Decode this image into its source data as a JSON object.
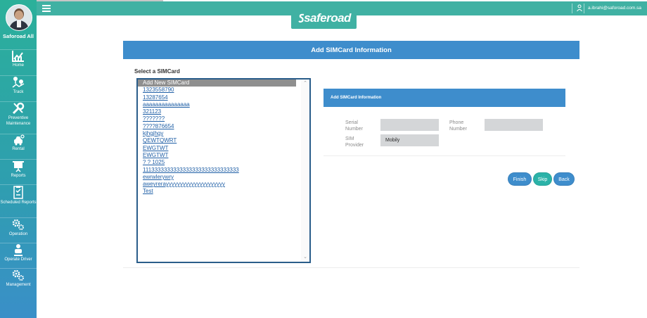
{
  "sidebar": {
    "user_name": "Saforoad All",
    "items": [
      {
        "label": "Home",
        "icon": "chart-icon"
      },
      {
        "label": "Track",
        "icon": "track-icon"
      },
      {
        "label": "Preventive Maintenance",
        "icon": "wrench-icon"
      },
      {
        "label": "Rental",
        "icon": "car-key-icon"
      },
      {
        "label": "Reports",
        "icon": "presentation-icon"
      },
      {
        "label": "Scheduled Reports",
        "icon": "clipboard-icon"
      },
      {
        "label": "Operation",
        "icon": "gears-icon"
      },
      {
        "label": "Operate Driver",
        "icon": "driver-icon"
      },
      {
        "label": "Management",
        "icon": "gears-icon"
      }
    ]
  },
  "topbar": {
    "email": "a.ibrahi@saforoad.com.sa"
  },
  "logo": {
    "text": "saferoad"
  },
  "page": {
    "title": "Add SIMCard Information",
    "select_label": "Select a SIMCard"
  },
  "simcards": [
    "Add New SIMCard",
    "1323558790",
    "13287654",
    "aaaaaaaaaaaaaaa",
    "321123",
    "???????",
    "????876654",
    "kjhgjhgy",
    "QEWTQWRT",
    "EWGTWT",
    "EWGTWT",
    "? ? 1025",
    "1113333333333333333333333333333",
    "ewrwlerywry",
    "aweyrerayyyyyyyyyyyyyyyyyyyyy",
    "Test"
  ],
  "panel": {
    "title": "Add SIMCard Information",
    "serial_label_1": "Serial",
    "serial_label_2": "Number",
    "phone_label_1": "Phone",
    "phone_label_2": "Number",
    "provider_label_1": "SIM",
    "provider_label_2": "Provider",
    "provider_value": "Mobily",
    "serial_value": "",
    "phone_value": ""
  },
  "buttons": {
    "finish": "Finish",
    "skip": "Skip",
    "back": "Back"
  },
  "colors": {
    "primary": "#3e8dcc",
    "teal": "#40b1a3",
    "link": "#1f5fa6"
  }
}
